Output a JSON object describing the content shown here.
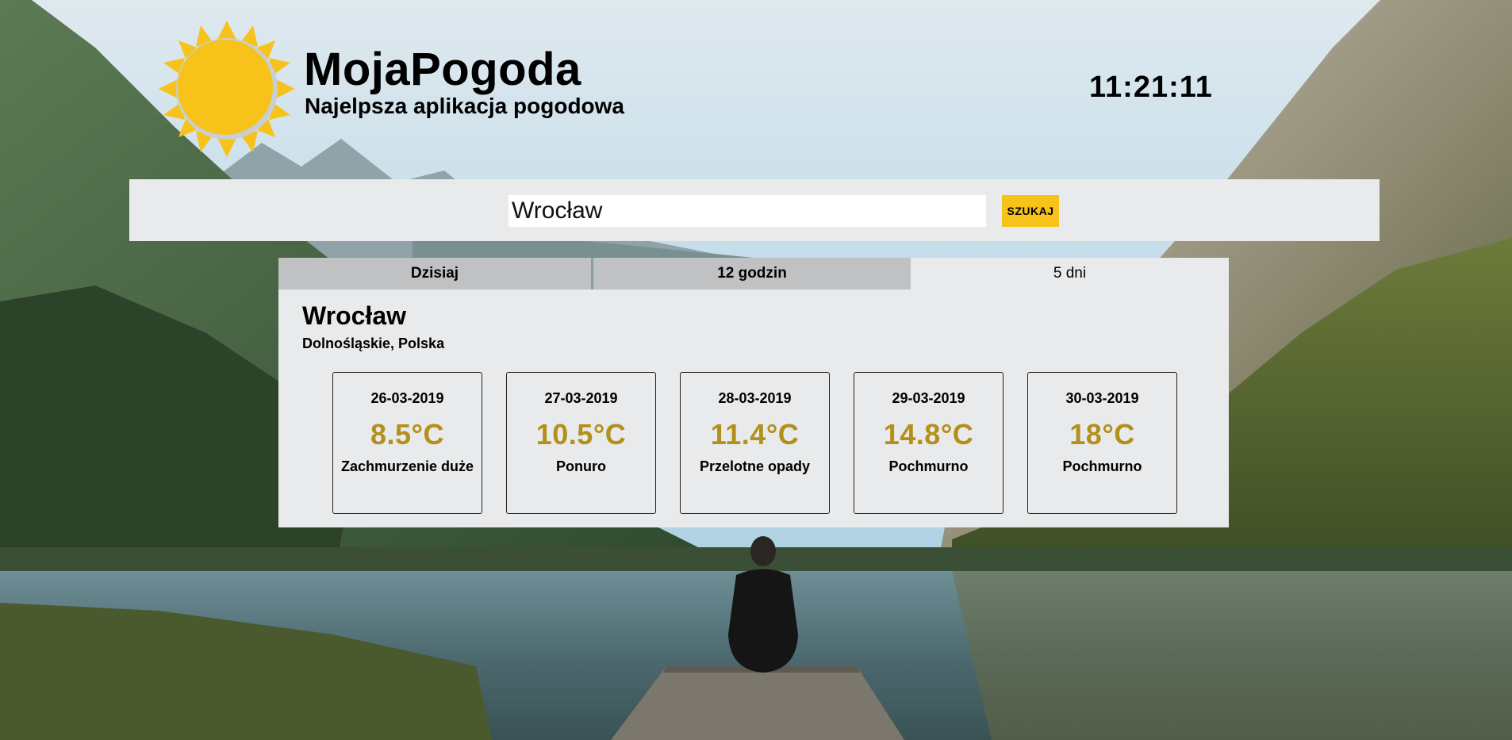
{
  "header": {
    "title": "MojaPogoda",
    "subtitle": "Najelpsza aplikacja pogodowa",
    "clock": "11:21:11"
  },
  "search": {
    "value": "Wrocław",
    "button_label": "SZUKAJ"
  },
  "tabs": [
    {
      "label": "Dzisiaj",
      "active": false
    },
    {
      "label": "12 godzin",
      "active": false
    },
    {
      "label": "5 dni",
      "active": true
    }
  ],
  "location": {
    "city": "Wrocław",
    "region": "Dolnośląskie, Polska"
  },
  "forecast": [
    {
      "date": "26-03-2019",
      "temp": "8.5°C",
      "desc": "Zachmurzenie duże"
    },
    {
      "date": "27-03-2019",
      "temp": "10.5°C",
      "desc": "Ponuro"
    },
    {
      "date": "28-03-2019",
      "temp": "11.4°C",
      "desc": "Przelotne opady"
    },
    {
      "date": "29-03-2019",
      "temp": "14.8°C",
      "desc": "Pochmurno"
    },
    {
      "date": "30-03-2019",
      "temp": "18°C",
      "desc": "Pochmurno"
    }
  ],
  "colors": {
    "accent": "#f7c21a",
    "temperature": "#b3901a",
    "panel": "#e9eaeb",
    "tab_inactive": "#bfc1c3"
  }
}
